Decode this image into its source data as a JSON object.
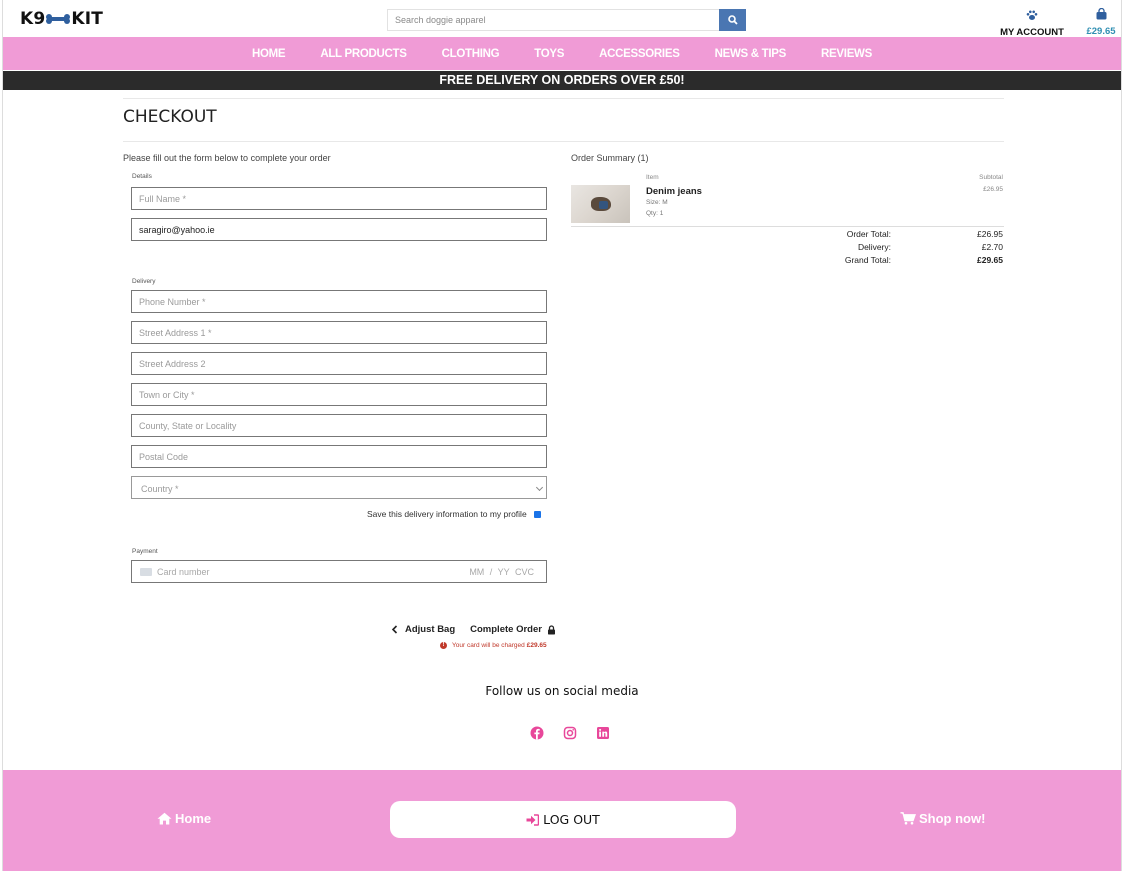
{
  "header": {
    "logo_left": "K9",
    "logo_right": "KIT",
    "search_placeholder": "Search doggie apparel",
    "account_label": "MY ACCOUNT",
    "bag_total": "£29.65"
  },
  "nav": [
    "HOME",
    "ALL PRODUCTS",
    "CLOTHING",
    "TOYS",
    "ACCESSORIES",
    "NEWS & TIPS",
    "REVIEWS"
  ],
  "banner": "FREE DELIVERY ON ORDERS OVER £50!",
  "page_title": "CHECKOUT",
  "form": {
    "lead": "Please fill out the form below to complete your order",
    "details_label": "Details",
    "full_name_placeholder": "Full Name *",
    "email_value": "saragiro@yahoo.ie",
    "delivery_label": "Delivery",
    "phone_placeholder": "Phone Number *",
    "street1_placeholder": "Street Address 1 *",
    "street2_placeholder": "Street Address 2",
    "town_placeholder": "Town or City *",
    "county_placeholder": "County, State or Locality",
    "postcode_placeholder": "Postal Code",
    "country_placeholder": "Country *",
    "save_info_label": "Save this delivery information to my profile",
    "save_info_checked": true,
    "payment_label": "Payment",
    "card_placeholder": "Card number",
    "card_expiry": "MM / YY  CVC"
  },
  "actions": {
    "adjust_bag": "Adjust Bag",
    "complete_order": "Complete Order",
    "charge_note": "Your card will be charged",
    "charge_amount": "£29.65"
  },
  "summary": {
    "title": "Order Summary (1)",
    "item_col": "Item",
    "subtotal_col": "Subtotal",
    "item": {
      "name": "Denim jeans",
      "size": "Size: M",
      "qty": "Qty: 1",
      "subtotal": "£26.95"
    },
    "order_total_label": "Order Total:",
    "order_total": "£26.95",
    "delivery_label": "Delivery:",
    "delivery": "£2.70",
    "grand_total_label": "Grand Total:",
    "grand_total": "£29.65"
  },
  "social": {
    "title": "Follow us on social media",
    "icons": [
      "facebook-icon",
      "instagram-icon",
      "linkedin-icon"
    ]
  },
  "footer": {
    "home": "Home",
    "logout": "LOG OUT",
    "shop": "Shop now!"
  },
  "colors": {
    "pink": "#f09bd6",
    "banner": "#2b2b2b",
    "search_button": "#4a76b2",
    "bag_price": "#2f8fb2",
    "social_icon": "#e8479a",
    "error": "#c0392b"
  }
}
